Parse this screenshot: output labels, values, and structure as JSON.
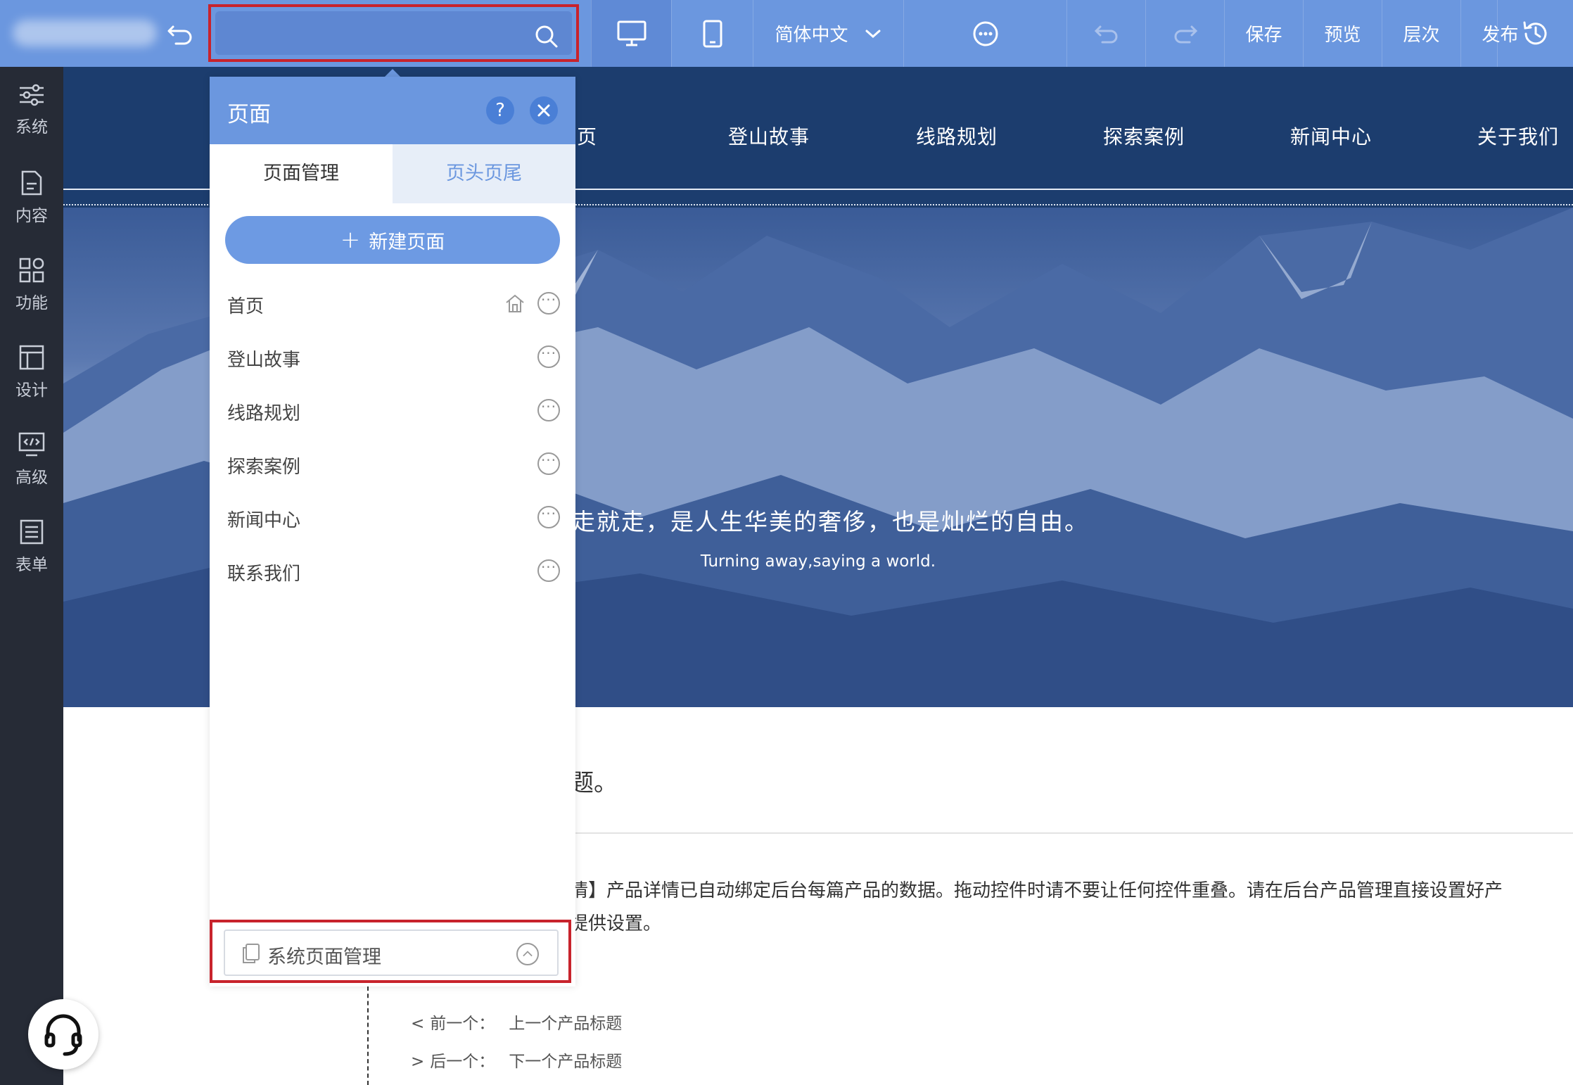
{
  "toolbar": {
    "search_placeholder": "",
    "language": "简体中文",
    "save": "保存",
    "preview": "预览",
    "layers": "层次",
    "publish": "发布"
  },
  "sidebar": {
    "items": [
      {
        "label": "系统",
        "icon": "sliders-icon"
      },
      {
        "label": "内容",
        "icon": "document-icon"
      },
      {
        "label": "功能",
        "icon": "grid-icon"
      },
      {
        "label": "设计",
        "icon": "layout-icon"
      },
      {
        "label": "高级",
        "icon": "code-icon"
      },
      {
        "label": "表单",
        "icon": "form-icon"
      }
    ]
  },
  "site": {
    "nav": [
      "页",
      "登山故事",
      "线路规划",
      "探索案例",
      "新闻中心",
      "关于我们"
    ],
    "hero_title": "说走就走，是人生华美的奢侈，也是灿烂的自由。",
    "hero_subtitle": "Turning away,saying a world.",
    "content_title": "题。",
    "content_line1": "情】产品详情已自动绑定后台每篇产品的数据。拖动控件时请不要让任何控件重叠。请在后台产品管理直接设置好产",
    "content_line2": "提供设置。",
    "prev_label": "前一个：",
    "prev_value": "上一个产品标题",
    "next_label": "后一个：",
    "next_value": "下一个产品标题"
  },
  "panel": {
    "title": "页面",
    "help": "?",
    "tabs": [
      "页面管理",
      "页头页尾"
    ],
    "new_page": "新建页面",
    "pages": [
      "首页",
      "登山故事",
      "线路规划",
      "探索案例",
      "新闻中心",
      "联系我们"
    ],
    "system_pages": "系统页面管理"
  },
  "colors": {
    "toolbar": "#6b97df",
    "sidebar": "#262b36",
    "site_nav": "#1c3d6e",
    "highlight": "#c8232c"
  }
}
